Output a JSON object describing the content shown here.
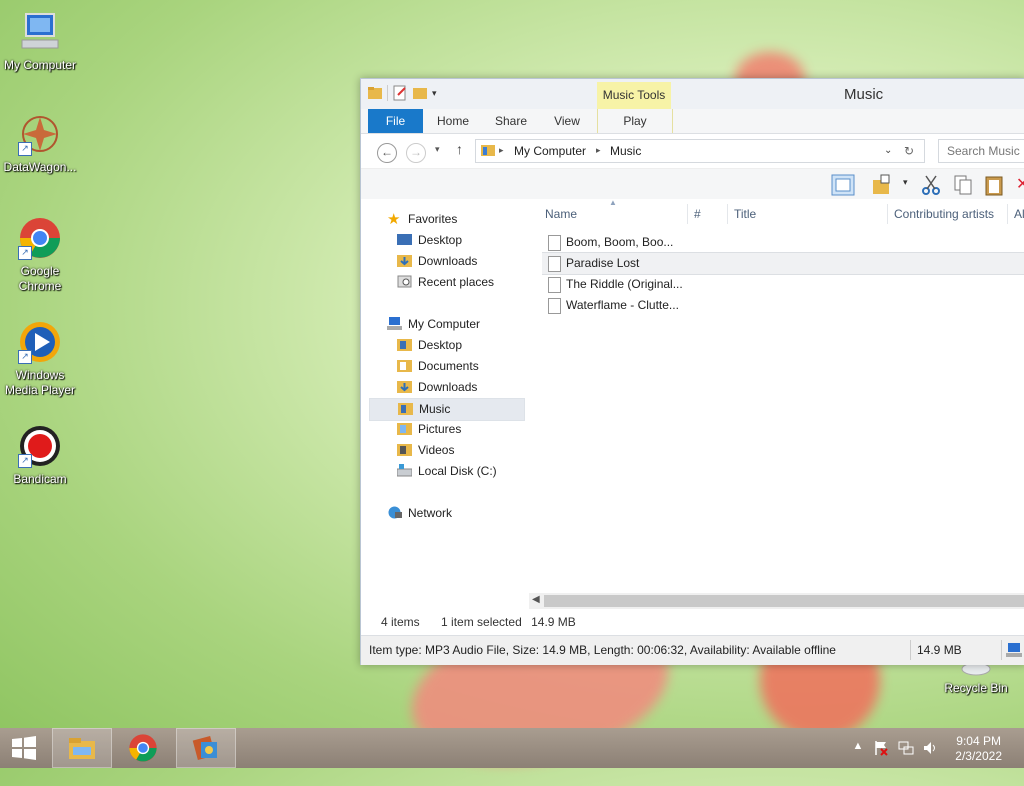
{
  "desktop": {
    "icons": [
      {
        "label": "My Computer",
        "icon": "computer-icon"
      },
      {
        "label": "DataWagon...",
        "icon": "datawagon-icon"
      },
      {
        "label": "Google Chrome",
        "icon": "chrome-icon"
      },
      {
        "label": "Windows Media Player",
        "icon": "media-player-icon"
      },
      {
        "label": "Bandicam",
        "icon": "bandicam-icon"
      },
      {
        "label": "Recycle Bin",
        "icon": "recycle-bin-icon"
      }
    ]
  },
  "window": {
    "title": "Music",
    "context_tab": "Music Tools",
    "tabs": [
      "File",
      "Home",
      "Share",
      "View",
      "Play"
    ],
    "address": {
      "root": "My Computer",
      "folder": "Music"
    },
    "search_placeholder": "Search Music",
    "nav": {
      "favorites": {
        "label": "Favorites",
        "items": [
          "Desktop",
          "Downloads",
          "Recent places"
        ]
      },
      "computer": {
        "label": "My Computer",
        "items": [
          "Desktop",
          "Documents",
          "Downloads",
          "Music",
          "Pictures",
          "Videos",
          "Local Disk (C:)"
        ]
      },
      "network": "Network",
      "selected": "Music"
    },
    "columns": [
      "Name",
      "#",
      "Title",
      "Contributing artists",
      "Al"
    ],
    "files": [
      "Boom, Boom, Boo...",
      "Paradise Lost",
      "The Riddle (Original...",
      "Waterflame - Clutte..."
    ],
    "selected_file": "Paradise Lost",
    "status": {
      "items": "4 items",
      "selected": "1 item selected",
      "size": "14.9 MB"
    },
    "details": {
      "text": "Item type: MP3 Audio File, Size: 14.9 MB, Length: 00:06:32, Availability: Available offline",
      "size": "14.9 MB"
    }
  },
  "taskbar": {
    "time": "9:04 PM",
    "date": "2/3/2022"
  },
  "colors": {
    "accent": "#1979ca",
    "context_tab": "#f7f3a7"
  }
}
